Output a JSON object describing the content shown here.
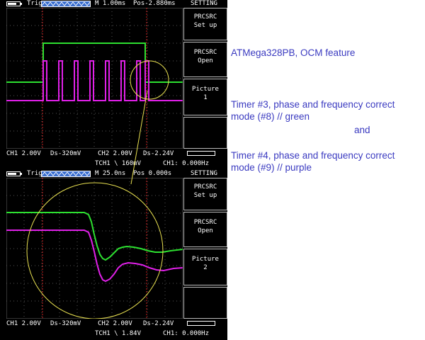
{
  "scope1": {
    "trig": "Trig",
    "timebase": "M 1.00ms",
    "pos": "Pos-2.880ms",
    "mode": "SETTING",
    "menu": [
      {
        "l1": "PRCSRC",
        "l2": "Set up"
      },
      {
        "l1": "PRCSRC",
        "l2": "Open"
      },
      {
        "l1": "Picture",
        "l2": "1"
      }
    ],
    "ch1": "CH1 2.00V",
    "ds1": "Ds-320mV",
    "ch2": "CH2 2.00V",
    "ds2": "Ds-2.24V",
    "trigger": "TCH1 \\ 160mV",
    "freq": "CH1: 0.000Hz"
  },
  "scope2": {
    "trig": "Trig",
    "timebase": "M 25.0ns",
    "pos": "Pos 0.000s",
    "mode": "SETTING",
    "menu": [
      {
        "l1": "PRCSRC",
        "l2": "Set up"
      },
      {
        "l1": "PRCSRC",
        "l2": "Open"
      },
      {
        "l1": "Picture",
        "l2": "2"
      }
    ],
    "ch1": "CH1 2.00V",
    "ds1": "Ds-320mV",
    "ch2": "CH2 2.00V",
    "ds2": "Ds-2.24V",
    "trigger": "TCH1 \\ 1.84V",
    "freq": "CH1: 0.000Hz"
  },
  "notes": {
    "title": "ATMega328PB, OCM feature",
    "timer3_line1": "Timer #3, phase and frequency correct",
    "timer3_line2": "mode (#8) // green",
    "and": "and",
    "timer4_line1": "Timer #4, phase and frequency correct",
    "timer4_line2": "mode (#9) // purple"
  },
  "colors": {
    "green": "#2de030",
    "purple": "#e020e8",
    "grid": "#555555",
    "highlight_circle": "#e8e050",
    "text_blue": "#3a3ac0",
    "cursor_red": "#cc2020"
  }
}
